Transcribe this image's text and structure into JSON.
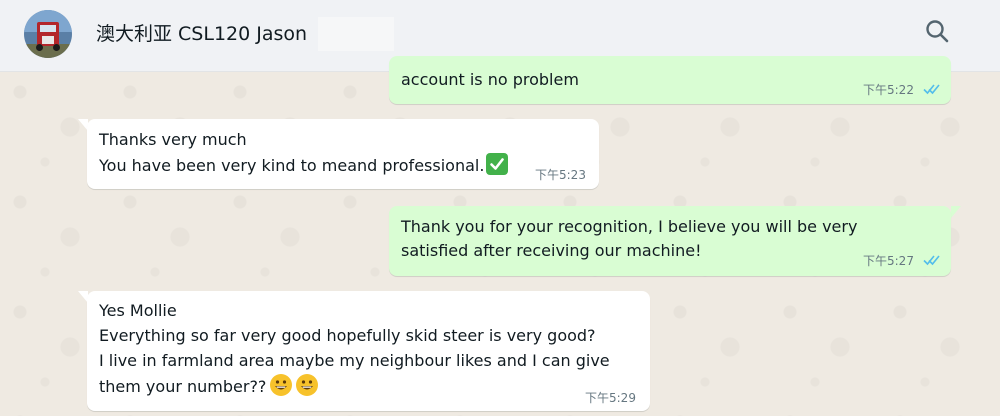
{
  "header": {
    "contact_name": "澳大利亚 CSL120 Jason",
    "search_icon": "search-icon"
  },
  "messages": [
    {
      "direction": "outgoing",
      "lines": [
        "account is no problem"
      ],
      "time": "下午5:22",
      "status": "read"
    },
    {
      "direction": "incoming",
      "lines": [
        "Thanks very much",
        "You have been very kind to meand professional."
      ],
      "emoji": [
        "check-mark-button"
      ],
      "time": "下午5:23"
    },
    {
      "direction": "outgoing",
      "lines": [
        "Thank you for your recognition, I believe you will be very",
        "satisfied after receiving our machine!"
      ],
      "time": "下午5:27",
      "status": "read"
    },
    {
      "direction": "incoming",
      "lines": [
        "Yes Mollie",
        "Everything so far very good hopefully skid steer is very good?",
        "I live in farmland area maybe my neighbour likes and I can give",
        "them your number??"
      ],
      "emoji": [
        "grinning-face",
        "grinning-face"
      ],
      "time": "下午5:29"
    }
  ],
  "colors": {
    "outgoing_bubble": "#d9fdd3",
    "incoming_bubble": "#ffffff",
    "read_ticks": "#53bdeb",
    "chat_background": "#efeae2"
  }
}
